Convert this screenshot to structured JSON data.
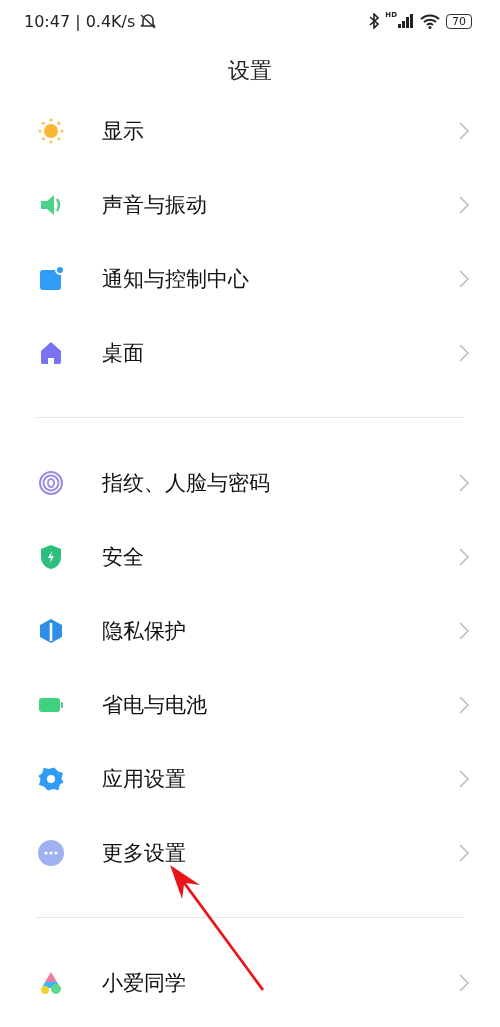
{
  "status_bar": {
    "time_speed": "10:47 | 0.4K/s",
    "signal_label": "HD",
    "battery": "70"
  },
  "title": "设置",
  "groups": [
    {
      "items": [
        {
          "kind": "sun",
          "label": "显示"
        },
        {
          "kind": "speaker",
          "label": "声音与振动"
        },
        {
          "kind": "notification",
          "label": "通知与控制中心"
        },
        {
          "kind": "home",
          "label": "桌面"
        }
      ]
    },
    {
      "items": [
        {
          "kind": "fingerprint",
          "label": "指纹、人脸与密码"
        },
        {
          "kind": "shield",
          "label": "安全"
        },
        {
          "kind": "privacy",
          "label": "隐私保护"
        },
        {
          "kind": "battery",
          "label": "省电与电池"
        },
        {
          "kind": "gear",
          "label": "应用设置"
        },
        {
          "kind": "more",
          "label": "更多设置"
        }
      ]
    },
    {
      "items": [
        {
          "kind": "assistant",
          "label": "小爱同学"
        }
      ]
    }
  ]
}
